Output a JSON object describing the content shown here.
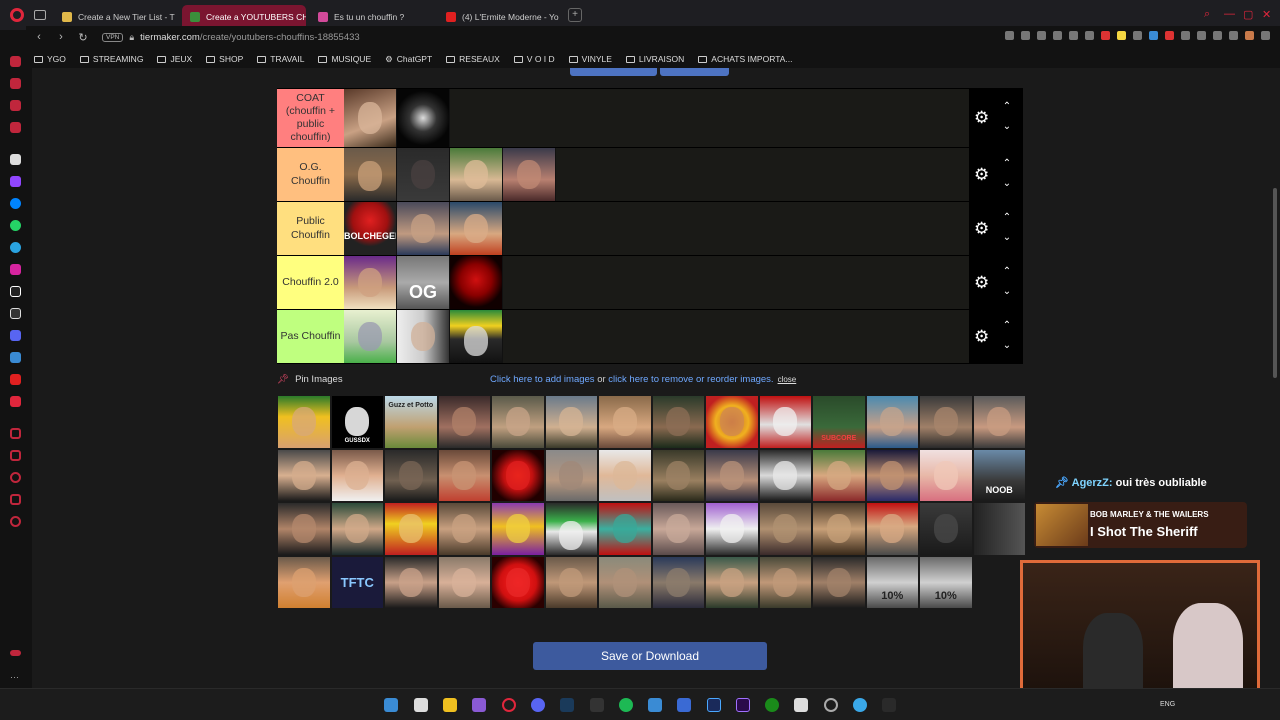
{
  "browser": {
    "tabs": [
      {
        "label": "Create a New Tier List - T",
        "active": false,
        "color": "#e0b84a"
      },
      {
        "label": "Create a YOUTUBERS CH",
        "active": true,
        "color": "#3b8f3b"
      },
      {
        "label": "Es tu un chouffin ?",
        "active": false,
        "color": "#d24a9a"
      },
      {
        "label": "(4) L'Ermite Moderne - Yo",
        "active": false,
        "color": "#e02020"
      }
    ],
    "vpn_label": "VPN",
    "url_host": "tiermaker.com",
    "url_path": "/create/youtubers-chouffins-18855433",
    "bookmarks": [
      "YGO",
      "STREAMING",
      "JEUX",
      "SHOP",
      "TRAVAIL",
      "MUSIQUE",
      "ChatGPT",
      "RESEAUX",
      "V O I D",
      "VINYLE",
      "LIVRAISON",
      "ACHATS IMPORTA..."
    ]
  },
  "tiers": [
    {
      "label": "COAT (chouffin + public chouffin)",
      "color": "#ff7f7f",
      "items": 2
    },
    {
      "label": "O.G. Chouffin",
      "color": "#ffbf7f",
      "items": 4
    },
    {
      "label": "Public Chouffin",
      "color": "#ffdf7f",
      "items": 3
    },
    {
      "label": "Chouffin 2.0",
      "color": "#ffff7f",
      "items": 3
    },
    {
      "label": "Pas Chouffin",
      "color": "#bfff7f",
      "items": 3
    }
  ],
  "tier_item_text": {
    "tier2_item0": "BOLCHEGEEK",
    "tier3_item1": "OG"
  },
  "pin": {
    "label": "Pin Images"
  },
  "links": {
    "add": "Click here to add images",
    "or": "or",
    "remove": "click here to remove or reorder images.",
    "close": "close"
  },
  "pool_count": 51,
  "pool_texts": {
    "p1": "GUSSDX",
    "p2": "Guzz et Potto",
    "p30": "SUBCORE",
    "p34": "NOOB",
    "p44": "TFTC",
    "p56": "10%",
    "p57": "10%"
  },
  "save_button": "Save or Download",
  "overlay": {
    "chat_user": "AgerzZ:",
    "chat_text": "oui très oubliable",
    "music_artist": "BOB MARLEY & THE WAILERS",
    "music_song": "I Shot The Sheriff"
  },
  "taskbar": {
    "lang": "ENG"
  },
  "colors": {
    "accent": "#e0263c",
    "link": "#6fa8ff",
    "save": "#3d5a9e"
  }
}
